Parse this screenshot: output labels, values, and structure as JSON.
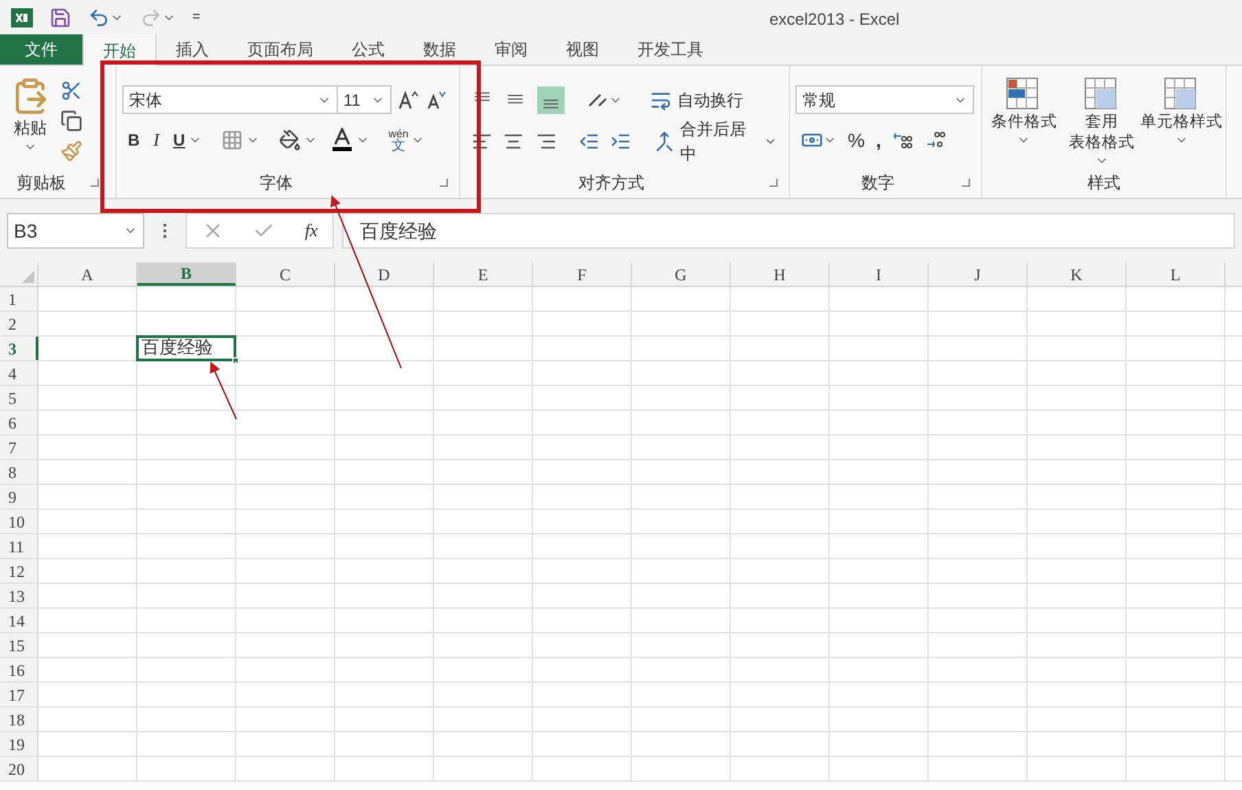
{
  "window": {
    "title": "excel2013 - Excel"
  },
  "quick_access": {
    "customize_glyph": "="
  },
  "tabs": [
    {
      "label": "文件",
      "kind": "file",
      "selected": false
    },
    {
      "label": "开始",
      "kind": "tab",
      "selected": true
    },
    {
      "label": "插入",
      "kind": "tab",
      "selected": false
    },
    {
      "label": "页面布局",
      "kind": "tab",
      "selected": false
    },
    {
      "label": "公式",
      "kind": "tab",
      "selected": false
    },
    {
      "label": "数据",
      "kind": "tab",
      "selected": false
    },
    {
      "label": "审阅",
      "kind": "tab",
      "selected": false
    },
    {
      "label": "视图",
      "kind": "tab",
      "selected": false
    },
    {
      "label": "开发工具",
      "kind": "tab",
      "selected": false
    }
  ],
  "ribbon": {
    "clipboard": {
      "paste": "粘贴",
      "label": "剪贴板"
    },
    "font": {
      "font_name": "宋体",
      "font_size": "11",
      "bold": "B",
      "italic": "I",
      "underline": "U",
      "phonetic_top": "wén",
      "phonetic_bottom": "文",
      "label": "字体"
    },
    "alignment": {
      "wrap_text": "自动换行",
      "merge_center": "合并后居中",
      "label": "对齐方式"
    },
    "number": {
      "format": "常规",
      "percent": "%",
      "comma": ",",
      "label": "数字"
    },
    "styles": {
      "items": [
        {
          "lines": [
            "条件格式"
          ]
        },
        {
          "lines": [
            "套用",
            "表格格式"
          ]
        },
        {
          "lines": [
            "单元格样式"
          ]
        }
      ],
      "label": "样式"
    }
  },
  "formula_bar": {
    "name_box": "B3",
    "fx": "fx",
    "value": "百度经验"
  },
  "sheet": {
    "columns": [
      {
        "label": "A",
        "selected": false
      },
      {
        "label": "B",
        "selected": true
      },
      {
        "label": "C",
        "selected": false
      },
      {
        "label": "D",
        "selected": false
      },
      {
        "label": "E",
        "selected": false
      },
      {
        "label": "F",
        "selected": false
      },
      {
        "label": "G",
        "selected": false
      },
      {
        "label": "H",
        "selected": false
      },
      {
        "label": "I",
        "selected": false
      },
      {
        "label": "J",
        "selected": false
      },
      {
        "label": "K",
        "selected": false
      },
      {
        "label": "L",
        "selected": false
      }
    ],
    "rows": [
      {
        "label": "1",
        "selected": false
      },
      {
        "label": "2",
        "selected": false
      },
      {
        "label": "3",
        "selected": true
      },
      {
        "label": "4",
        "selected": false
      },
      {
        "label": "5",
        "selected": false
      },
      {
        "label": "6",
        "selected": false
      },
      {
        "label": "7",
        "selected": false
      },
      {
        "label": "8",
        "selected": false
      },
      {
        "label": "9",
        "selected": false
      },
      {
        "label": "10",
        "selected": false
      },
      {
        "label": "11",
        "selected": false
      },
      {
        "label": "12",
        "selected": false
      },
      {
        "label": "13",
        "selected": false
      },
      {
        "label": "14",
        "selected": false
      },
      {
        "label": "15",
        "selected": false
      },
      {
        "label": "16",
        "selected": false
      },
      {
        "label": "17",
        "selected": false
      },
      {
        "label": "18",
        "selected": false
      },
      {
        "label": "19",
        "selected": false
      },
      {
        "label": "20",
        "selected": false
      }
    ],
    "active_cell": {
      "text": "百度经验"
    }
  }
}
